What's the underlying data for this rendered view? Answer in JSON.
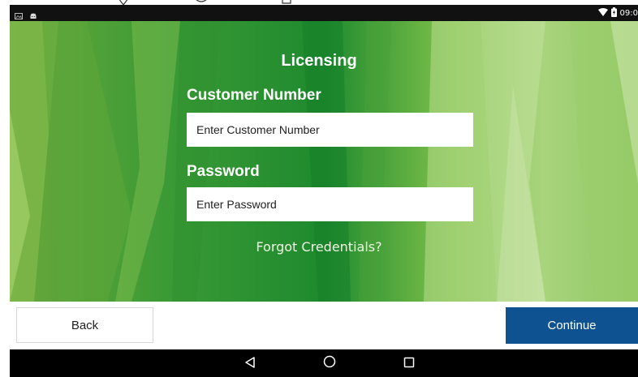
{
  "status_bar": {
    "time": "09:0"
  },
  "icons": {
    "gallery": "image-icon",
    "android": "android-icon",
    "wifi": "wifi-icon",
    "battery": "battery-icon",
    "back": "back-triangle-icon",
    "home": "home-circle-icon",
    "recents": "recents-square-icon"
  },
  "licensing": {
    "title": "Licensing",
    "customer_number_label": "Customer Number",
    "customer_number_placeholder": "Enter Customer Number",
    "customer_number_value": "",
    "password_label": "Password",
    "password_placeholder": "Enter Password",
    "password_value": "",
    "forgot_link": "Forgot Credentials?"
  },
  "actions": {
    "back_label": "Back",
    "continue_label": "Continue"
  },
  "colors": {
    "continue_bg": "#0e5291",
    "status_bar_bg": "#111111",
    "nav_bar_bg": "#000000",
    "background_green_dark": "#1e8a2e",
    "background_green_light": "#b5d98a"
  }
}
